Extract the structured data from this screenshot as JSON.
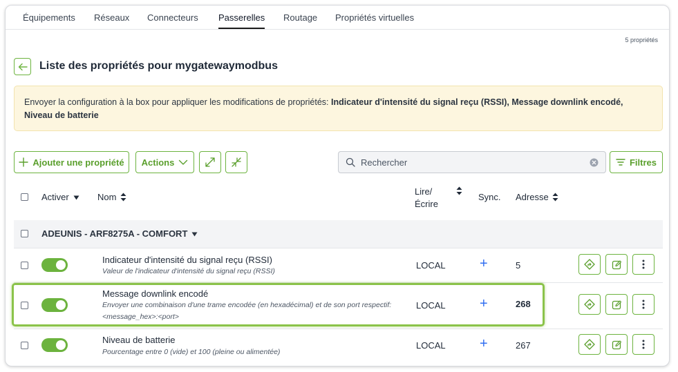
{
  "tabs": [
    "Équipements",
    "Réseaux",
    "Connecteurs",
    "Passerelles",
    "Routage",
    "Propriétés virtuelles"
  ],
  "active_tab": "Passerelles",
  "count_label": "5 propriétés",
  "page_title": "Liste des propriétés pour mygatewaymodbus",
  "banner": {
    "prefix": "Envoyer la configuration à la box pour appliquer les modifications de propriétés: ",
    "items": "Indicateur d'intensité du signal reçu (RSSI), Message downlink encodé, Niveau de batterie"
  },
  "toolbar": {
    "add_label": "Ajouter une propriété",
    "actions_label": "Actions",
    "search_placeholder": "Rechercher",
    "filters_label": "Filtres"
  },
  "table": {
    "headers": {
      "activer": "Activer",
      "nom": "Nom",
      "rw_line1": "Lire/",
      "rw_line2": "Écrire",
      "sync": "Sync.",
      "adresse": "Adresse"
    },
    "group": "ADEUNIS - ARF8275A - COMFORT",
    "rows": [
      {
        "name": "Indicateur d'intensité du signal reçu (RSSI)",
        "description": "Valeur de l'indicateur d'intensité du signal reçu (RSSI)",
        "rw": "LOCAL",
        "sync": "+",
        "address": "5",
        "enabled": true
      },
      {
        "name": "Message downlink encodé",
        "description": "Envoyer une combinaison d'une trame encodée (en hexadécimal) et de son port respectif: <message_hex>:<port>",
        "rw": "LOCAL",
        "sync": "+",
        "address": "268",
        "enabled": true
      },
      {
        "name": "Niveau de batterie",
        "description": "Pourcentage entre 0 (vide) et 100 (pleine ou alimentée)",
        "rw": "LOCAL",
        "sync": "+",
        "address": "267",
        "enabled": true
      }
    ]
  },
  "colors": {
    "accent": "#6cb33e",
    "highlight": "#8bc34a",
    "sync_blue": "#2f6df0",
    "banner_bg": "#fdf6df"
  }
}
